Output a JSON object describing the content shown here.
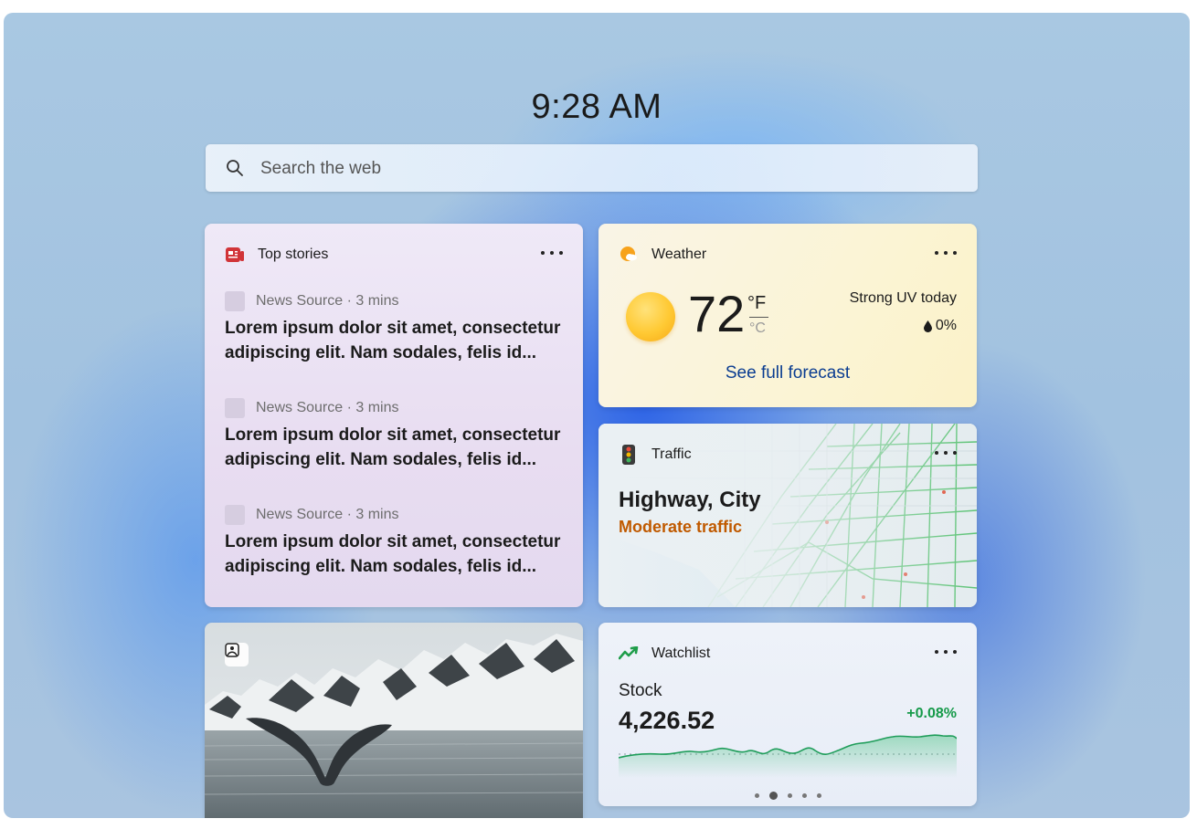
{
  "clock": {
    "time": "9:28 AM"
  },
  "search": {
    "placeholder": "Search the web",
    "icon": "search-icon"
  },
  "top_stories": {
    "title": "Top stories",
    "icon": "news-icon",
    "items": [
      {
        "source": "News Source · 3 mins",
        "headline_line1": "Lorem ipsum dolor sit amet, consectetur",
        "headline_line2": "adipiscing elit. Nam sodales, felis id..."
      },
      {
        "source": "News Source · 3 mins",
        "headline_line1": "Lorem ipsum dolor sit amet, consectetur",
        "headline_line2": "adipiscing elit. Nam sodales, felis id..."
      },
      {
        "source": "News Source · 3 mins",
        "headline_line1": "Lorem ipsum dolor sit amet, consectetur",
        "headline_line2": "adipiscing elit. Nam sodales, felis id..."
      }
    ]
  },
  "weather": {
    "title": "Weather",
    "icon": "partly-cloudy-icon",
    "condition_icon": "sunny-icon",
    "temperature": "72",
    "unit_f": "°F",
    "unit_c": "°C",
    "uv": "Strong UV today",
    "precip": "0%",
    "link": "See full forecast"
  },
  "traffic": {
    "title": "Traffic",
    "icon": "traffic-light-icon",
    "location": "Highway, City",
    "status": "Moderate traffic",
    "status_color": "#c05a00"
  },
  "photo": {
    "icon": "photo-icon"
  },
  "watchlist": {
    "title": "Watchlist",
    "icon": "stock-trend-icon",
    "label": "Stock",
    "price": "4,226.52",
    "change": "+0.08%",
    "change_color": "#169a4a",
    "pager": {
      "pages": 5,
      "active": 2
    }
  },
  "colors": {
    "accent_link": "#0b3d91",
    "traffic_green": "#3fb55b"
  }
}
